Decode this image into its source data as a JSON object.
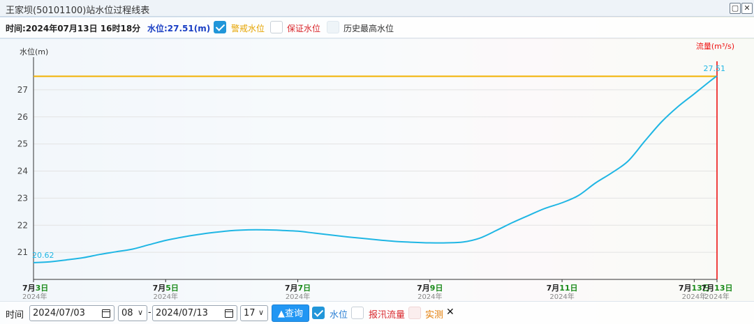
{
  "window": {
    "title": "王家坝(50101100)站水位过程线表"
  },
  "toolbar": {
    "time_text": "时间:2024年07月13日 16时18分",
    "level_text": "水位:27.51(m)",
    "legend_warning": "警戒水位",
    "legend_guarantee": "保证水位",
    "legend_historic": "历史最高水位"
  },
  "bottom": {
    "time_label": "时间",
    "start_date": "2024/07/03",
    "start_hour": "08",
    "dash": "-",
    "end_date": "2024/07/13",
    "end_hour": "17",
    "query_label": "▲查询",
    "cb_level": "水位",
    "cb_flood": "报汛流量",
    "cb_measured": "实测",
    "close": "✕"
  },
  "colors": {
    "warning": "#f2b100",
    "guarantee": "#d9262b",
    "historic": "#666666",
    "series": "#1fb6e4",
    "now": "#ee1111",
    "date_green": "#1a8a1a"
  },
  "chart_data": {
    "type": "line",
    "title": "",
    "ylabel": "水位(m)",
    "y2label": "流量(m³/s)",
    "ylim": [
      20.0,
      28.0
    ],
    "yticks": [
      21,
      22,
      23,
      24,
      25,
      26,
      27
    ],
    "xlim": [
      0,
      10.345
    ],
    "x_tick_labels": [
      {
        "x": 0,
        "month": "7月",
        "day": "3日",
        "year": "2024年"
      },
      {
        "x": 2.0,
        "month": "7月",
        "day": "5日",
        "year": "2024年"
      },
      {
        "x": 4.0,
        "month": "7月",
        "day": "7日",
        "year": "2024年"
      },
      {
        "x": 6.0,
        "month": "7月",
        "day": "9日",
        "year": "2024年"
      },
      {
        "x": 8.0,
        "month": "7月",
        "day": "11日",
        "year": "2024年"
      },
      {
        "x": 10.0,
        "month": "7月",
        "day": "13日",
        "year": "2024年"
      },
      {
        "x": 10.345,
        "month": "7月",
        "day": "13日",
        "year": "2024年"
      }
    ],
    "warning_level": 27.5,
    "now_x": 10.345,
    "series": [
      {
        "name": "水位",
        "x": [
          0,
          0.25,
          0.5,
          0.75,
          1.0,
          1.25,
          1.5,
          1.75,
          2.0,
          2.25,
          2.5,
          2.75,
          3.0,
          3.25,
          3.5,
          3.75,
          4.0,
          4.25,
          4.5,
          4.75,
          5.0,
          5.25,
          5.5,
          5.75,
          6.0,
          6.25,
          6.5,
          6.75,
          7.0,
          7.25,
          7.5,
          7.75,
          8.0,
          8.25,
          8.5,
          8.75,
          9.0,
          9.25,
          9.5,
          9.75,
          10.0,
          10.25,
          10.345
        ],
        "values": [
          20.62,
          20.65,
          20.72,
          20.8,
          20.92,
          21.02,
          21.12,
          21.28,
          21.44,
          21.56,
          21.66,
          21.74,
          21.8,
          21.83,
          21.83,
          21.81,
          21.78,
          21.71,
          21.64,
          21.57,
          21.51,
          21.45,
          21.4,
          21.37,
          21.35,
          21.35,
          21.38,
          21.52,
          21.8,
          22.1,
          22.37,
          22.63,
          22.83,
          23.1,
          23.55,
          23.93,
          24.37,
          25.1,
          25.8,
          26.37,
          26.85,
          27.34,
          27.51
        ],
        "start_label": "20.62",
        "end_label": "27.51"
      }
    ],
    "grid": true,
    "legend": "top"
  }
}
